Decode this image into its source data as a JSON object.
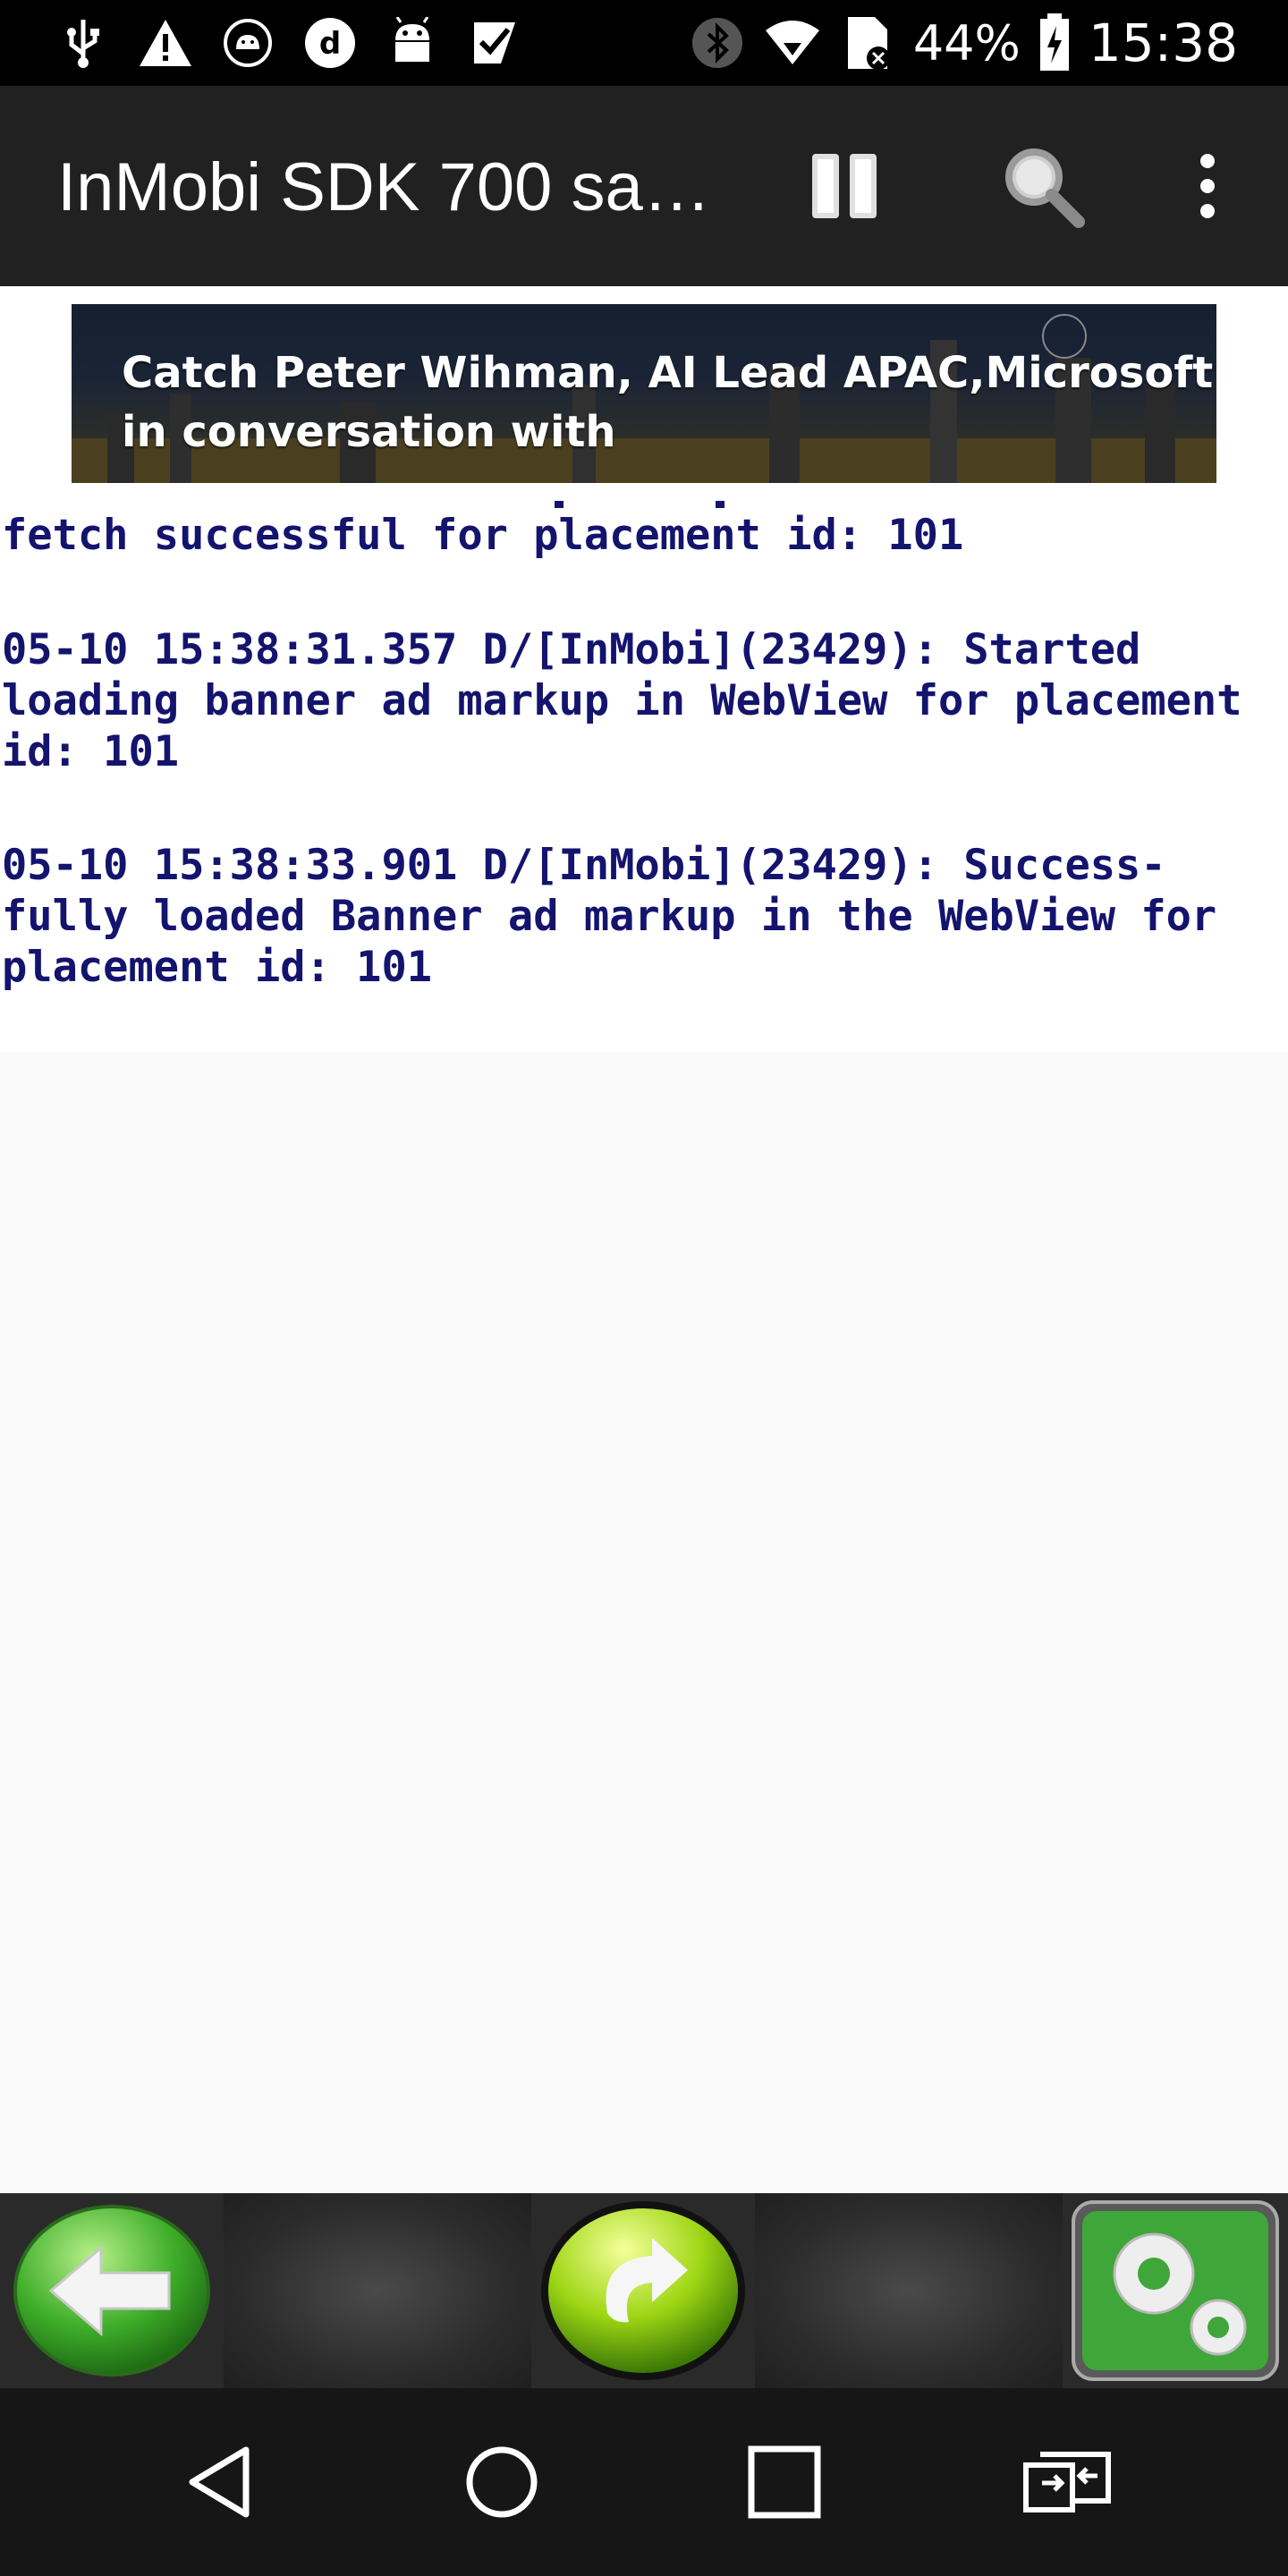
{
  "status_bar": {
    "icons_left": [
      "usb-icon",
      "warning-icon",
      "android-debug-icon",
      "d-app-icon",
      "android-icon",
      "task-check-icon"
    ],
    "icons_right": [
      "bluetooth-icon",
      "wifi-icon",
      "sim-no-signal-icon"
    ],
    "battery_percent": "44%",
    "battery_icon": "battery-charging-icon",
    "time": "15:38"
  },
  "app_bar": {
    "title": "InMobi SDK 700 sa…",
    "actions": [
      "pause-icon",
      "search-icon",
      "more-options-icon"
    ]
  },
  "ad_banner": {
    "line1": "Catch Peter Wihman, AI Lead APAC,Microsoft",
    "line2": "in conversation with"
  },
  "log": {
    "entries": [
      {
        "text": "fetch successful for placement id: 101"
      },
      {
        "text": "05-10 15:38:31.357 D/[InMobi](23429): Started\nloading banner ad markup in WebView for placement\nid: 101"
      },
      {
        "text": "05-10 15:38:33.901 D/[InMobi](23429): Success-\nfully loaded Banner ad markup in the WebView for\nplacement id: 101"
      }
    ]
  },
  "toolbar": {
    "buttons": [
      "back-arrow-icon",
      "refresh-icon",
      "settings-gears-icon"
    ]
  },
  "nav_bar": {
    "buttons": [
      "nav-back-icon",
      "nav-home-icon",
      "nav-recents-icon",
      "screen-mirror-icon"
    ]
  },
  "colors": {
    "app_bar": "#212121",
    "log_text": "#14146e",
    "green_button": "#3fae2a"
  }
}
